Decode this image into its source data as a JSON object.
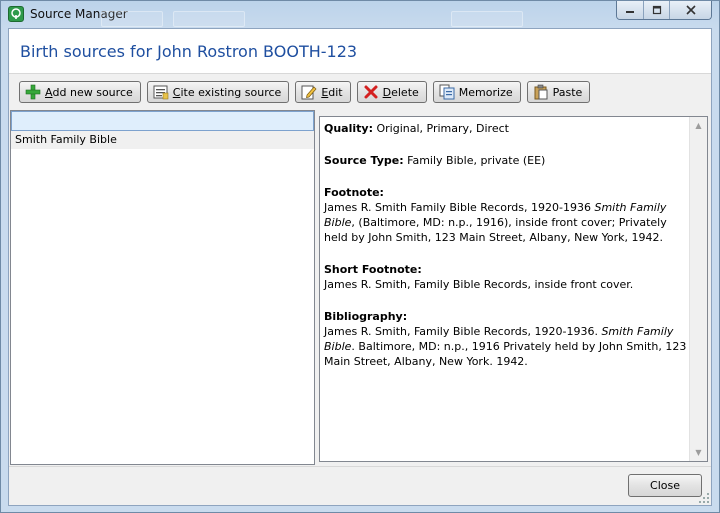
{
  "window": {
    "title": "Source Manager"
  },
  "header": {
    "title": "Birth sources for John Rostron BOOTH-123"
  },
  "toolbar": {
    "buttons": [
      {
        "label": "Add new source",
        "mnemonic": "A",
        "rest": "dd new source",
        "icon": "plus-icon"
      },
      {
        "label": "Cite existing source",
        "mnemonic": "C",
        "rest": "ite existing source",
        "icon": "cite-icon"
      },
      {
        "label": "Edit",
        "mnemonic": "E",
        "rest": "dit",
        "icon": "edit-icon"
      },
      {
        "label": "Delete",
        "mnemonic": "D",
        "rest": "elete",
        "icon": "delete-icon"
      },
      {
        "label": "Memorize",
        "mnemonic": "",
        "rest": "Memorize",
        "icon": "memorize-icon"
      },
      {
        "label": "Paste",
        "mnemonic": "",
        "rest": "Paste",
        "icon": "paste-icon"
      }
    ]
  },
  "sources": {
    "header_value": "",
    "items": [
      "Smith Family Bible"
    ]
  },
  "details": {
    "quality_label": "Quality:",
    "quality_value": "Original, Primary, Direct",
    "source_type_label": "Source Type:",
    "source_type_value": "Family Bible, private (EE)",
    "footnote_label": "Footnote:",
    "footnote_part1": "James R. Smith Family Bible Records, 1920-1936 ",
    "footnote_italic": "Smith Family Bible",
    "footnote_part2": ", (Baltimore, MD: n.p., 1916), inside front cover; Privately held by John Smith, 123 Main Street, Albany, New York, 1942.",
    "short_footnote_label": "Short Footnote:",
    "short_footnote_value": "James R. Smith, Family Bible Records, inside front cover.",
    "bibliography_label": "Bibliography:",
    "bibliography_part1": "James R. Smith, Family Bible Records, 1920-1936. ",
    "bibliography_italic": "Smith Family Bible",
    "bibliography_part2": ". Baltimore, MD: n.p., 1916 Privately held by John Smith, 123 Main Street, Albany, New York. 1942."
  },
  "footer": {
    "close_label": "Close"
  },
  "colors": {
    "header_title": "#1f4fa0",
    "selected_row_bg": "#dfeefc"
  }
}
